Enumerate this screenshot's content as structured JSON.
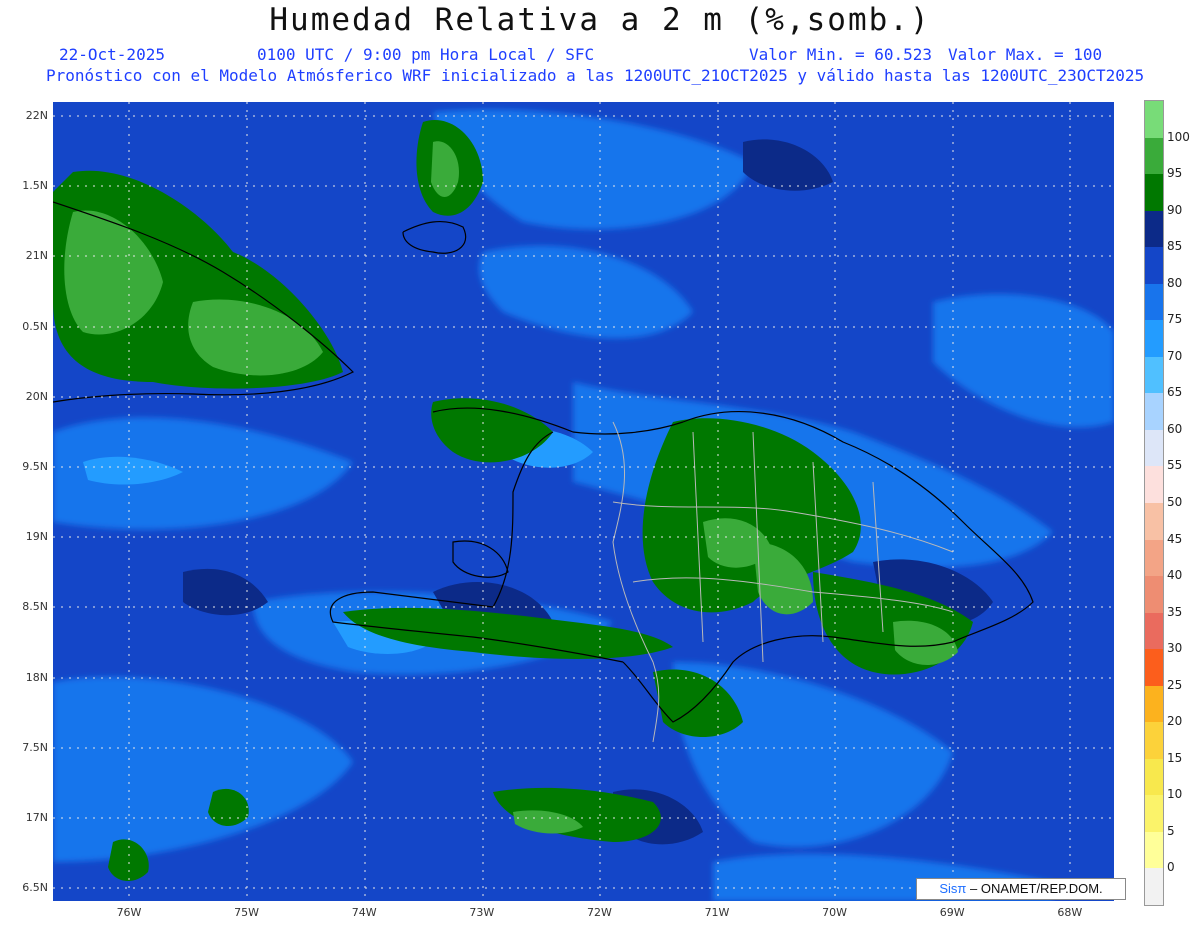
{
  "title": "Humedad Relativa a 2 m (%,somb.)",
  "info": {
    "date": "22-Oct-2025",
    "time": "0100 UTC / 9:00 pm Hora Local / SFC",
    "min": "Valor Min. = 60.523",
    "max": "Valor Max. = 100",
    "model": "Pronóstico con el Modelo Atmósferico WRF inicializado a las 1200UTC_21OCT2025 y válido hasta las  1200UTC_23OCT2025"
  },
  "axes": {
    "lat_labels": [
      "22N",
      "1.5N",
      "21N",
      "0.5N",
      "20N",
      "9.5N",
      "19N",
      "8.5N",
      "18N",
      "7.5N",
      "17N",
      "6.5N"
    ],
    "lon_labels": [
      "76W",
      "75W",
      "74W",
      "73W",
      "72W",
      "71W",
      "70W",
      "69W",
      "68W"
    ]
  },
  "legend": {
    "labels": [
      "0",
      "5",
      "10",
      "15",
      "20",
      "25",
      "30",
      "35",
      "40",
      "45",
      "50",
      "55",
      "60",
      "65",
      "70",
      "75",
      "80",
      "85",
      "90",
      "95",
      "100"
    ],
    "colors": [
      "#f2f2f2",
      "#ffff99",
      "#fbf36a",
      "#f8e84d",
      "#fcd23a",
      "#fcb21e",
      "#fc5e1c",
      "#ea6b5e",
      "#ee8d72",
      "#f3a486",
      "#f8c1a5",
      "#fde0dd",
      "#dde6f8",
      "#a8d3ff",
      "#50c0ff",
      "#239cff",
      "#1874ec",
      "#1446c8",
      "#0c2a88",
      "#007800",
      "#3aab3a",
      "#78dc78"
    ]
  },
  "credit": {
    "sis": "Sisπ",
    "rest": "– ONAMET/REP.DOM."
  }
}
